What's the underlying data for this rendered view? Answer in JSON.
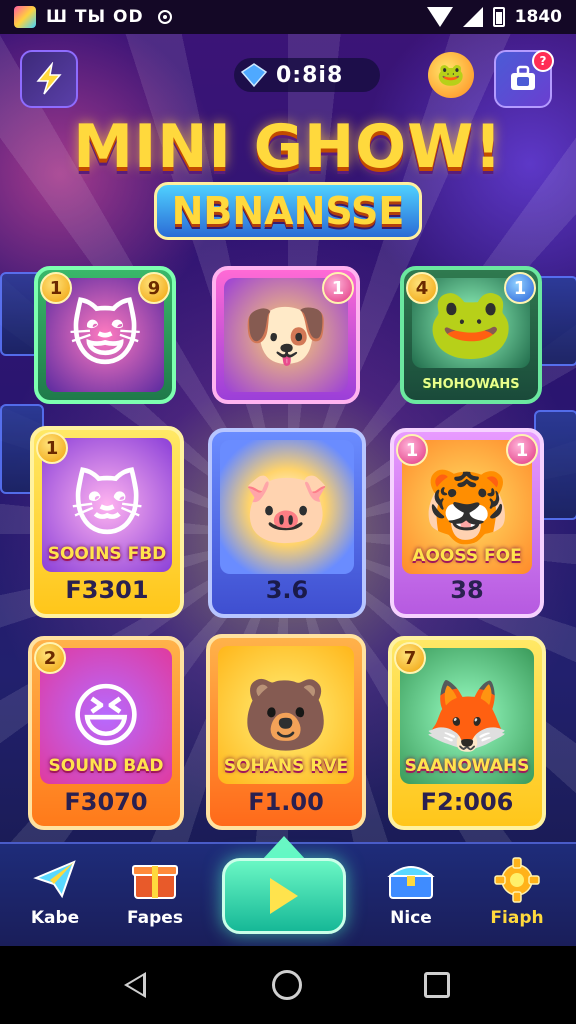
{
  "status_bar": {
    "carrier": "Ш TЫ OD",
    "time": "1840"
  },
  "header": {
    "timer": "0:8i8",
    "notification_count": "?"
  },
  "title": {
    "line1": "MINI GHOW!",
    "line2": "NBNANSSE"
  },
  "cards": [
    {
      "badge_left": "1",
      "badge_right": "9",
      "label": "",
      "price": "",
      "face": "😺"
    },
    {
      "badge_left": "",
      "badge_right": "1",
      "label": "",
      "price": "",
      "face": "🐶"
    },
    {
      "badge_left": "4",
      "badge_right": "1",
      "label": "SHOHOWAHS",
      "price": "",
      "face": "🐸"
    },
    {
      "badge_left": "1",
      "badge_right": "",
      "label": "SOOINS FBD",
      "price": "F3301",
      "face": "🐱"
    },
    {
      "badge_left": "",
      "badge_right": "",
      "label": "",
      "price": "3.6",
      "face": "🐷"
    },
    {
      "badge_left": "1",
      "badge_right": "1",
      "label": "AOOSS FOE",
      "price": "38",
      "face": "🐯"
    },
    {
      "badge_left": "2",
      "badge_right": "",
      "label": "SOUND BAD",
      "price": "F3070",
      "face": "😆"
    },
    {
      "badge_left": "",
      "badge_right": "",
      "label": "SOHANS RVE",
      "price": "F1.00",
      "face": "🐻"
    },
    {
      "badge_left": "7",
      "badge_right": "",
      "label": "SAANOWAHS",
      "price": "F2:006",
      "face": "🦊"
    }
  ],
  "nav": {
    "items": [
      {
        "label": "Kabe",
        "icon": "paper-plane-icon"
      },
      {
        "label": "Fapes",
        "icon": "gift-box-icon"
      },
      {
        "label": "Nice",
        "icon": "treasure-chest-icon"
      },
      {
        "label": "Fiaph",
        "icon": "gear-icon"
      }
    ],
    "play_icon": "play-icon"
  },
  "colors": {
    "title": "#ffd93d",
    "play_button": "#16b897",
    "active_nav": "#ffd93d"
  }
}
